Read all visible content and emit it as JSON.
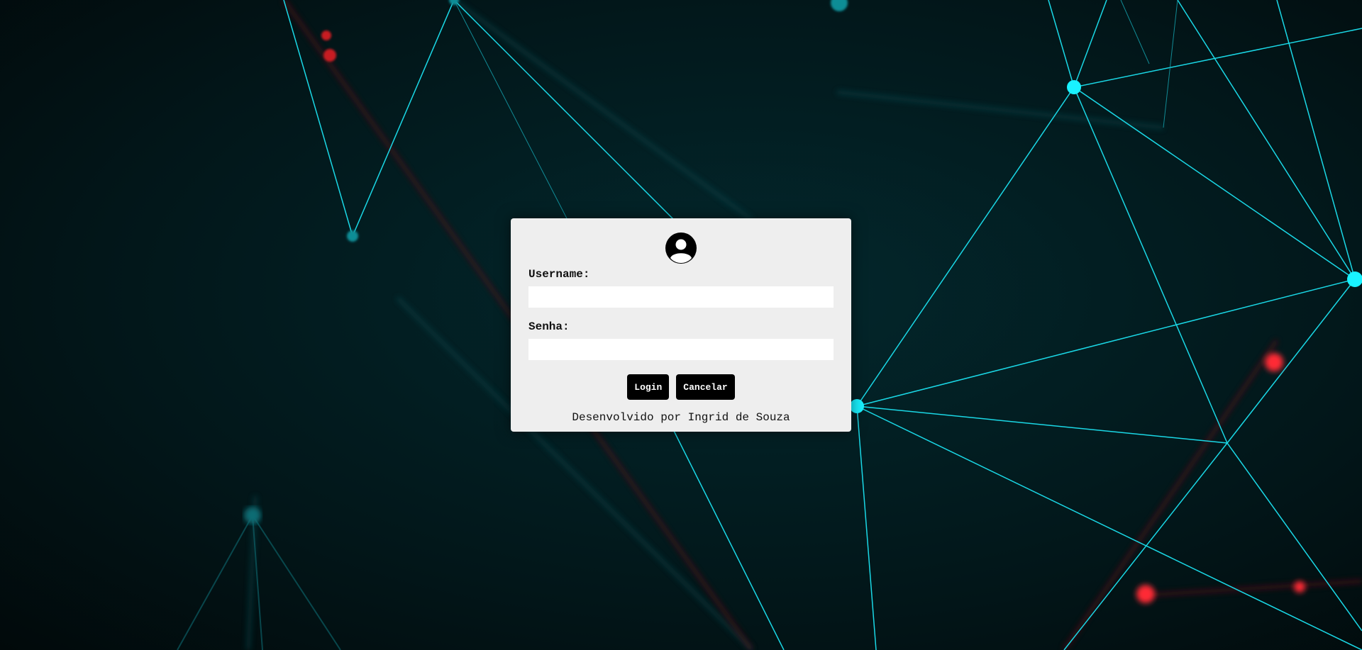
{
  "background": {
    "description_icon": "network-lines-icon",
    "accent_cyan": "#00e5ff",
    "accent_red": "#ff2b2b"
  },
  "login": {
    "avatar_icon": "user-avatar-icon",
    "username_label": "Username:",
    "username_value": "",
    "password_label": "Senha:",
    "password_value": "",
    "login_button": "Login",
    "cancel_button": "Cancelar",
    "credit": "Desenvolvido por Ingrid de Souza"
  }
}
